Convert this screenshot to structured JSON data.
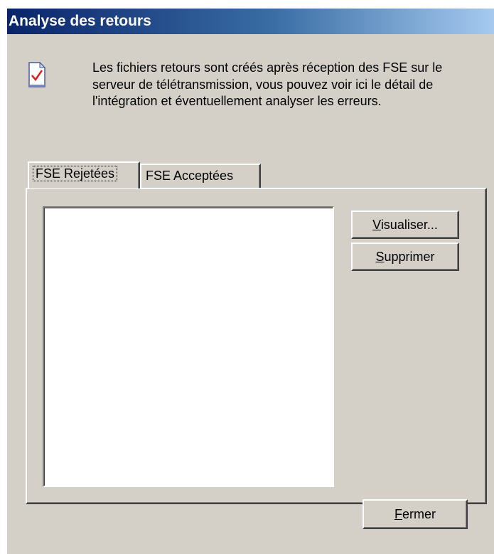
{
  "window": {
    "title": "Analyse des retours"
  },
  "info": {
    "icon": "document-check-icon",
    "text": "Les fichiers retours sont créés après réception des FSE sur le serveur de télétransmission, vous pouvez voir ici le détail de l'intégration et éventuellement analyser les erreurs."
  },
  "tabs": [
    {
      "label": "FSE Rejetées",
      "selected": true
    },
    {
      "label": "FSE Acceptées",
      "selected": false
    }
  ],
  "buttons": {
    "visualiser": {
      "mnemonic": "V",
      "rest": "isualiser..."
    },
    "supprimer": {
      "mnemonic": "S",
      "rest": "upprimer"
    },
    "fermer": {
      "mnemonic": "F",
      "rest": "ermer"
    }
  }
}
